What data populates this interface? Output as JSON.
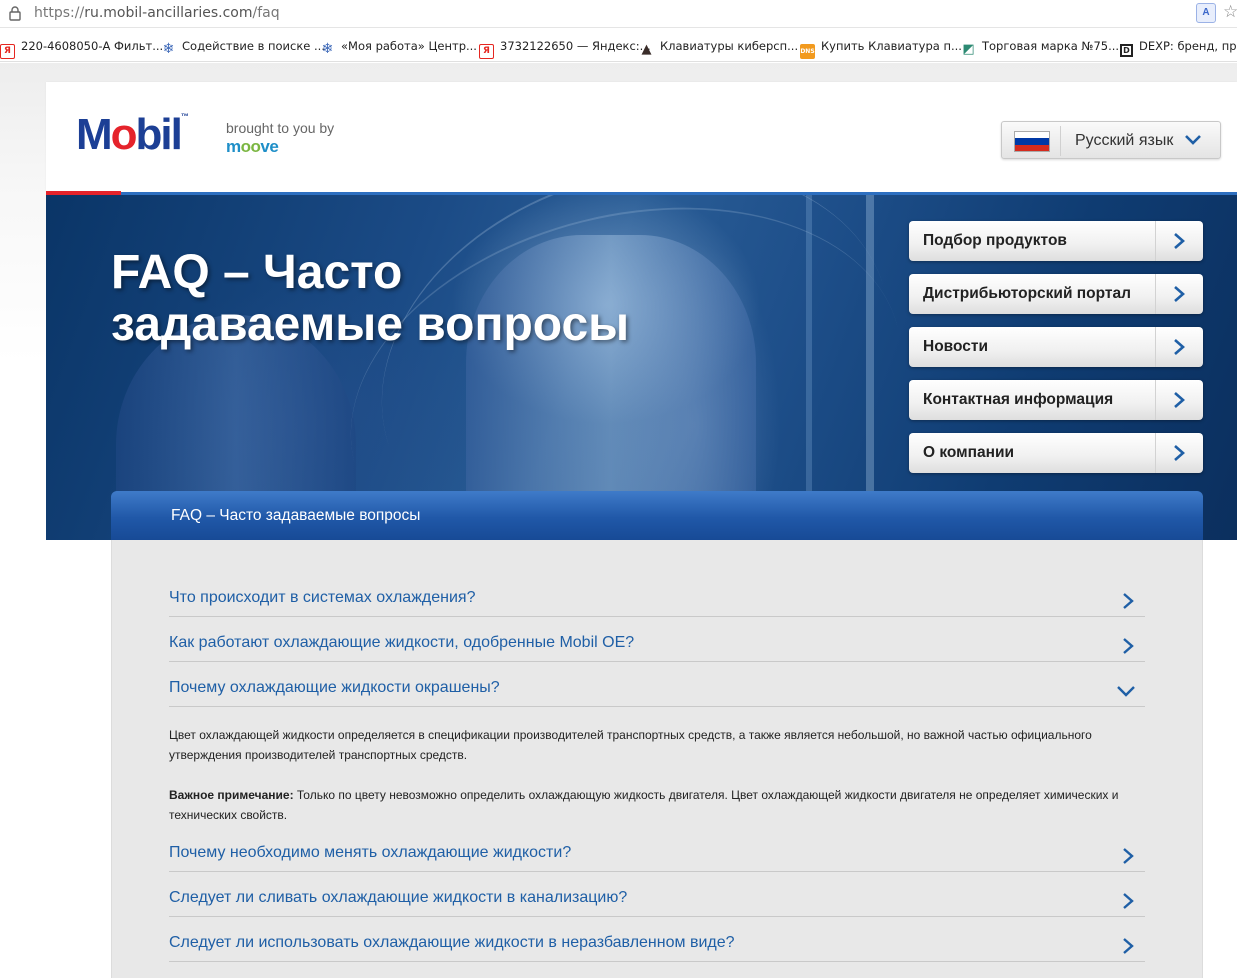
{
  "browser": {
    "url_scheme": "https://",
    "url_host": "ru.mobil-ancillaries.com",
    "url_path": "/faq",
    "bookmarks": [
      {
        "icon": "yandex-icon",
        "label": "220-4608050-А Фильт..."
      },
      {
        "icon": "snowflake-icon",
        "label": "Содействие в поиске ..."
      },
      {
        "icon": "snowflake-icon",
        "label": "«Моя работа» Центр..."
      },
      {
        "icon": "yandex-icon",
        "label": "3732122650 — Яндекс:..."
      },
      {
        "icon": "hat-icon",
        "label": "Клавиатуры киберсп..."
      },
      {
        "icon": "dns-icon",
        "label": "Купить Клавиатура п..."
      },
      {
        "icon": "trademark-icon",
        "label": "Торговая марка №75..."
      },
      {
        "icon": "dexp-icon",
        "label": "DEXP: бренд, прои"
      }
    ]
  },
  "header": {
    "logo_text": "Mobil",
    "brought_by": "brought to you by",
    "partner": "moove",
    "language": {
      "label": "Русский язык",
      "flag_colors": [
        "#ffffff",
        "#0039a6",
        "#d52b1e"
      ]
    }
  },
  "hero": {
    "title_line1": "FAQ – Часто",
    "title_line2": "задаваемые вопросы"
  },
  "side_nav": [
    {
      "label": "Подбор продуктов"
    },
    {
      "label": "Дистрибьюторский портал"
    },
    {
      "label": "Новости"
    },
    {
      "label": "Контактная информация"
    },
    {
      "label": "О компании"
    }
  ],
  "breadcrumb": "FAQ – Часто задаваемые вопросы",
  "faq": [
    {
      "question": "Что происходит в системах охлаждения?",
      "expanded": false
    },
    {
      "question": "Как работают охлаждающие жидкости, одобренные Mobil OE?",
      "expanded": false
    },
    {
      "question": "Почему охлаждающие жидкости окрашены?",
      "expanded": true
    },
    {
      "question": "Почему необходимо менять охлаждающие жидкости?",
      "expanded": false
    },
    {
      "question": "Следует ли сливать охлаждающие жидкости в канализацию?",
      "expanded": false
    },
    {
      "question": "Следует ли использовать охлаждающие жидкости в неразбавленном виде?",
      "expanded": false
    }
  ],
  "answer": {
    "paragraph1_line1": "Цвет охлаждающей жидкости определяется в спецификации производителей транспортных средств, а также является небольшой, но важной частью официального",
    "paragraph1_line2": "утверждения производителей транспортных средств.",
    "note_label": "Важное примечание:",
    "note_line1": " Только по цвету невозможно определить охлаждающую жидкость двигателя. Цвет охлаждающей жидкости двигателя не определяет химических и",
    "note_line2": "технических свойств."
  },
  "colors": {
    "brand_blue": "#1c3f95",
    "brand_red": "#e5232b",
    "link_blue": "#1f5fa6",
    "crumb_blue": "#2058a8"
  }
}
